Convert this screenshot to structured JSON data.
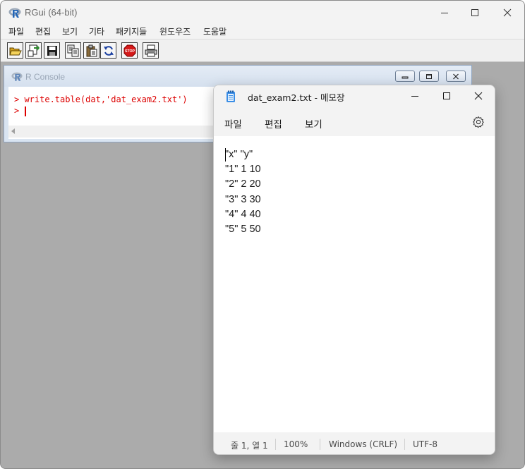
{
  "rgui": {
    "title": "RGui (64-bit)",
    "menu": [
      "파일",
      "편집",
      "보기",
      "기타",
      "패키지들",
      "윈도우즈",
      "도움말"
    ],
    "toolbar_icons": [
      "open-script-icon",
      "load-workspace-icon",
      "save-icon",
      "copy-icon",
      "paste-icon",
      "refresh-icon",
      "stop-icon",
      "print-icon"
    ],
    "stop_label": "STOP"
  },
  "console": {
    "title": "R Console",
    "lines": [
      "> write.table(dat,'dat_exam2.txt')",
      ">"
    ]
  },
  "notepad": {
    "title": "dat_exam2.txt - 메모장",
    "menu": [
      "파일",
      "편집",
      "보기"
    ],
    "content": "\"x\" \"y\"\n\"1\" 1 10\n\"2\" 2 20\n\"3\" 3 30\n\"4\" 4 40\n\"5\" 5 50",
    "status": {
      "position": "줄 1, 열 1",
      "zoom": "100%",
      "line_ending": "Windows (CRLF)",
      "encoding": "UTF-8"
    }
  },
  "colors": {
    "console_text": "#dd0000",
    "mdi_background": "#ababab",
    "console_titlebar": "#d9e4f1"
  }
}
